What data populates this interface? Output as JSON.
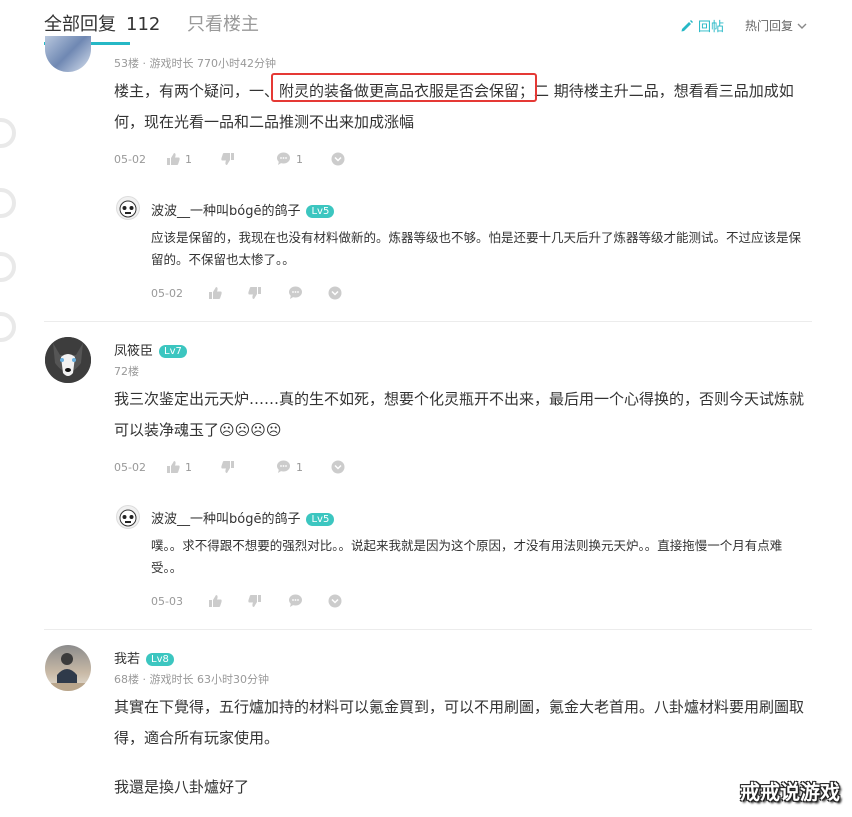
{
  "header": {
    "tab_all": "全部回复",
    "tab_all_count": "112",
    "tab_owner": "只看楼主",
    "reply_label": "回帖",
    "sort_label": "热门回复"
  },
  "posts": [
    {
      "floor_meta": "53楼 · 游戏时长 770小时42分钟",
      "content_pre": "楼主，有两个疑问，一、",
      "content_highlight": "附灵的装备做更高品衣服是否会保留",
      "content_post": "；二 期待楼主升二品，想看看三品加成如何，现在光看一品和二品推测不出来加成涨幅",
      "date": "05-02",
      "likes": "1",
      "comments": "1",
      "reply": {
        "name": "波波__一种叫bógē的鸽子",
        "level": "Lv5",
        "content": "应该是保留的，我现在也没有材料做新的。炼器等级也不够。怕是还要十几天后升了炼器等级才能测试。不过应该是保留的。不保留也太惨了。。",
        "date": "05-02"
      }
    },
    {
      "name": "凤筱臣",
      "level": "Lv7",
      "floor_meta": "72楼",
      "content": "我三次鉴定出元天炉……真的生不如死，想要个化灵瓶开不出来，最后用一个心得换的，否则今天试炼就可以装净魂玉了☹☹☹☹",
      "date": "05-02",
      "likes": "1",
      "comments": "1",
      "reply": {
        "name": "波波__一种叫bógē的鸽子",
        "level": "Lv5",
        "content": "噗。。求不得跟不想要的强烈对比。。说起来我就是因为这个原因，才没有用法则换元天炉。。直接拖慢一个月有点难受。。",
        "date": "05-03"
      }
    },
    {
      "name": "我若",
      "level": "Lv8",
      "floor_meta": "68楼 · 游戏时长 63小时30分钟",
      "content": "其實在下覺得，五行爐加持的材料可以氪金買到，可以不用刷圖，氪金大老首用。八卦爐材料要用刷圖取得，適合所有玩家使用。",
      "content2": "我還是換八卦爐好了"
    }
  ],
  "watermark": "戒戒说游戏",
  "colors": {
    "accent": "#26b8c6",
    "level_badge": "#3cc6c0",
    "highlight_border": "#e53935"
  }
}
